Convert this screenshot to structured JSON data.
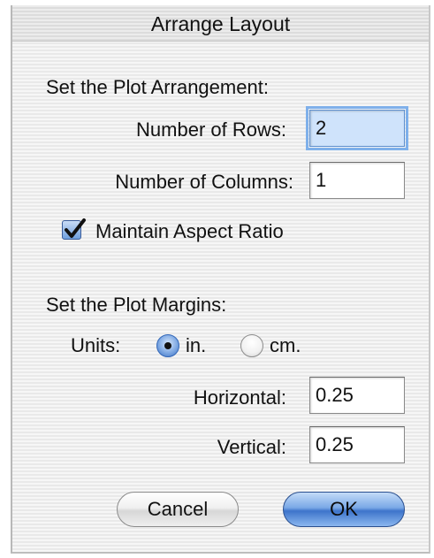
{
  "dialog": {
    "title": "Arrange Layout",
    "arrangement": {
      "heading": "Set the Plot Arrangement:",
      "rows_label": "Number of Rows:",
      "rows_value": "2",
      "columns_label": "Number of Columns:",
      "columns_value": "1",
      "aspect_label": "Maintain Aspect Ratio",
      "aspect_checked": true
    },
    "margins": {
      "heading": "Set the Plot Margins:",
      "units_label": "Units:",
      "unit_in_label": "in.",
      "unit_cm_label": "cm.",
      "selected_unit": "in.",
      "horizontal_label": "Horizontal:",
      "horizontal_value": "0.25",
      "vertical_label": "Vertical:",
      "vertical_value": "0.25"
    },
    "buttons": {
      "cancel_label": "Cancel",
      "ok_label": "OK"
    }
  }
}
